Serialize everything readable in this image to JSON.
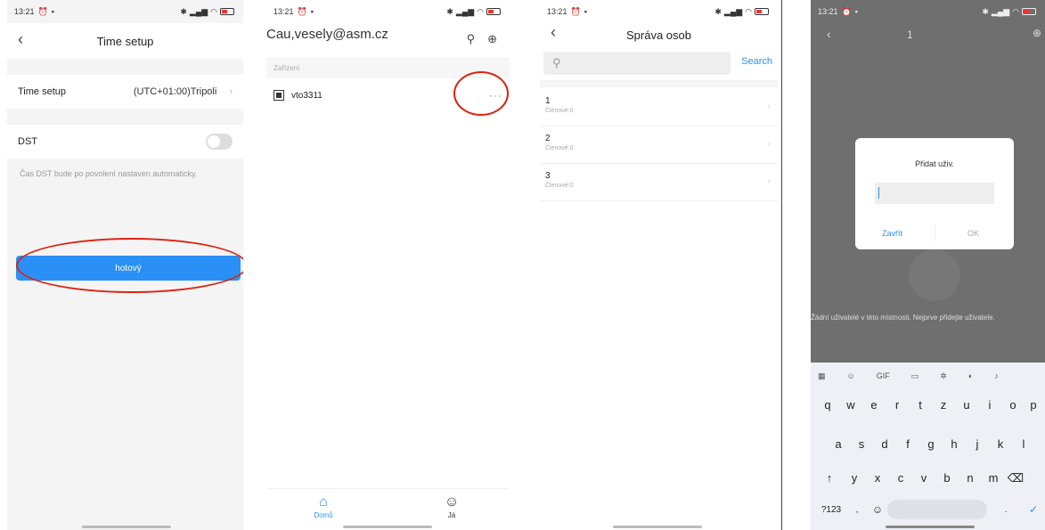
{
  "status": {
    "time": "13:21"
  },
  "panel1": {
    "title": "Time setup",
    "time_label": "Time setup",
    "time_value": "(UTC+01:00)Tripoli",
    "dst_label": "DST",
    "note": "Čas DST bude po povolení nastaven automaticky.",
    "done_button": "hotový"
  },
  "panel2": {
    "title": "Cau,vesely@asm.cz",
    "section_label": "Zařízení",
    "device_name": "vto3311",
    "more_label": "···",
    "tab_home": "Domů",
    "tab_me": "Já"
  },
  "panel3": {
    "title": "Správa osob",
    "search_button": "Search",
    "members": [
      {
        "name": "1",
        "sub": "Členové:0"
      },
      {
        "name": "2",
        "sub": "Členové:0"
      },
      {
        "name": "3",
        "sub": "Členové:0"
      }
    ]
  },
  "panel4": {
    "title": "1",
    "dialog_title": "Přidat uživ.",
    "close_button": "Zavřít",
    "ok_button": "OK",
    "empty_text": "Žádní uživatelé v této místnosti. Nejprve přidejte uživatele.",
    "gif_label": "GIF",
    "row1": [
      "q",
      "w",
      "e",
      "r",
      "t",
      "z",
      "u",
      "i",
      "o",
      "p"
    ],
    "row2": [
      "a",
      "s",
      "d",
      "f",
      "g",
      "h",
      "j",
      "k",
      "l"
    ],
    "row3": [
      "y",
      "x",
      "c",
      "v",
      "b",
      "n",
      "m"
    ],
    "sym_key": "?123",
    "comma_key": ",",
    "period_key": "."
  }
}
